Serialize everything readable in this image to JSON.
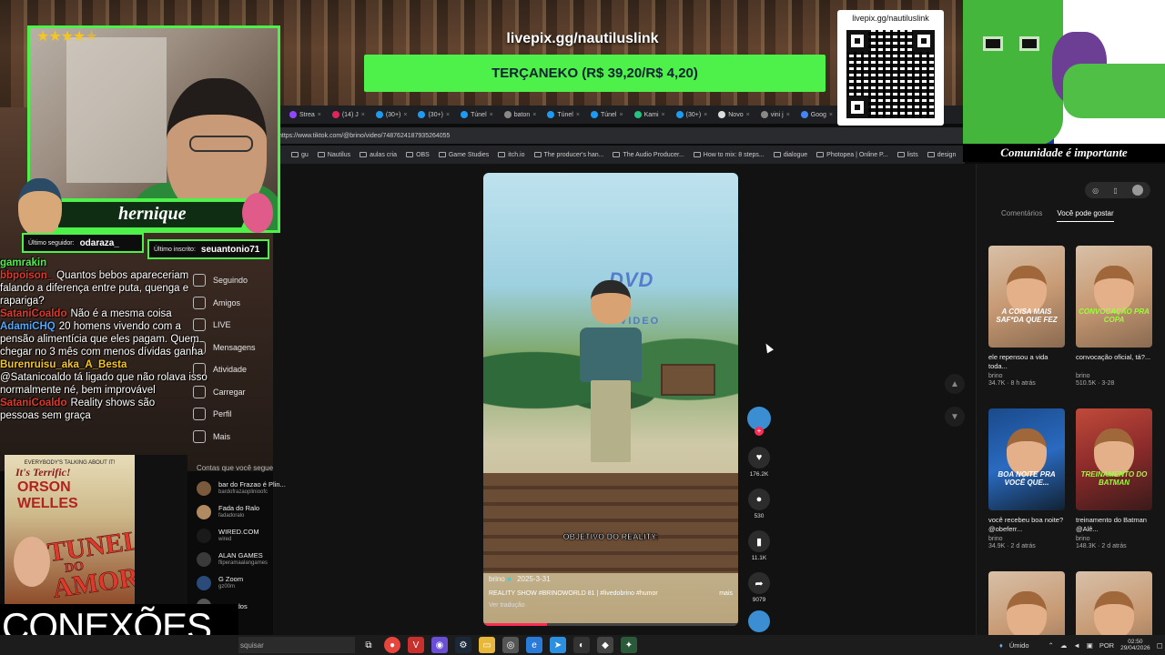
{
  "stream": {
    "livepix_url": "livepix.gg/nautiluslink",
    "goal_text": "TERÇANEKO (R$ 39,20/R$ 4,20)",
    "qr_label": "livepix.gg/nautiluslink",
    "community_tag": "Comunidade é importante",
    "streamer_name": "hernique",
    "star_rating": 4.5,
    "last_follower_label": "Último seguidor:",
    "last_follower": "odaraza_",
    "last_sub_label": "Último inscrito:",
    "last_sub": "seuantonio71",
    "accent_color": "#4ef04a",
    "bottom_banner": "CONEXÕES",
    "poster": {
      "tagline": "EVERYBODY'S TALKING ABOUT IT!",
      "terrific": "It's Terrific!",
      "actor_line1": "ORSON",
      "actor_line2": "WELLES",
      "title_line1": "TUNEL",
      "title_line2": "DO",
      "title_line3": "AMOR"
    }
  },
  "chat": [
    {
      "user": "gamrakin",
      "text": "",
      "color": "#4ef04a"
    },
    {
      "user": "bbpoison_",
      "text": "Quantos bebos apareceriam",
      "color": "#e0392b"
    },
    {
      "user": "",
      "text": "falando a diferença entre puta, quenga e",
      "color": "#fff"
    },
    {
      "user": "",
      "text": "rapariga?",
      "color": "#fff"
    },
    {
      "user": "SataniCoaldo",
      "text": "Não é a mesma coisa",
      "color": "#e0392b"
    },
    {
      "user": "AdamiCHQ",
      "text": "20 homens vivendo com a",
      "color": "#4fa8ff"
    },
    {
      "user": "",
      "text": "pensão alimentícia que eles pagam. Quem",
      "color": "#fff"
    },
    {
      "user": "",
      "text": "chegar no 3 mês com menos dívidas ganha",
      "color": "#fff"
    },
    {
      "user": "Burenruisu_aka_A_Besta",
      "text": "",
      "color": "#f6c51e"
    },
    {
      "user": "",
      "text": "@Satanicoaldo tá ligado que não rolava isso",
      "color": "#fff"
    },
    {
      "user": "",
      "text": "normalmente né, bem improvável",
      "color": "#fff"
    },
    {
      "user": "SataniCoaldo",
      "text": "Reality shows são",
      "color": "#e0392b"
    },
    {
      "user": "",
      "text": "pessoas sem graça",
      "color": "#fff"
    }
  ],
  "browser": {
    "tabs": [
      "Strea",
      "(14) J",
      "(30+)",
      "(30+)",
      "Túnel",
      "baton",
      "Túnel",
      "Túnel",
      "Kami",
      "(30+)",
      "Novo",
      "vini j",
      "Goog",
      "Dev"
    ],
    "url": "https://www.tiktok.com/@brino/video/7487624187935264055",
    "bookmarks": [
      "gu",
      "Nautilus",
      "aulas cria",
      "OBS",
      "Game Studies",
      "itch.io",
      "The producer's han...",
      "The Audio Producer...",
      "How to mix: 8 steps...",
      "dialogue",
      "Photopea | Online P...",
      "lists",
      "design"
    ]
  },
  "tiktok": {
    "nav": [
      "Seguindo",
      "Amigos",
      "LIVE",
      "Mensagens",
      "Atividade",
      "Carregar",
      "Perfil",
      "Mais"
    ],
    "following_title": "Contas que você segue",
    "accounts": [
      {
        "name": "bar do Frazao é Plin...",
        "handle": "bardofrazaoplinioofc"
      },
      {
        "name": "Fada do Ralo",
        "handle": "fadadoralo"
      },
      {
        "name": "WIRED.COM",
        "handle": "wired"
      },
      {
        "name": "ALAN GAMES",
        "handle": "fliperamaalangames"
      },
      {
        "name": "G Zoom",
        "handle": "gz00m"
      },
      {
        "name": "Ver todos",
        "handle": ""
      }
    ],
    "video": {
      "overlay_logo": "DVD",
      "overlay_logo_sub": "VIDEO",
      "caption": "OBJETIVO DO REALITY:",
      "author": "brino",
      "date": "2025-3-31",
      "description": "REALITY SHOW #BRINOWORLD 81 | #livedobrino #humor",
      "more_label": "mais",
      "translate_label": "Ver tradução",
      "progress": 0.25
    },
    "actions": {
      "likes": "176.2K",
      "comments": "530",
      "saves": "11.1K",
      "shares": "9079"
    },
    "right_tabs": [
      "Comentários",
      "Você pode gostar"
    ],
    "active_right_tab": "Você pode gostar",
    "suggestions": [
      {
        "thumb_caption": "A COISA MAIS SAF*DA QUE FEZ",
        "caption_color": "#ffffff",
        "title": "ele repensou a vida toda...",
        "author": "brino",
        "views": "34.7K",
        "age": "8 h atrás"
      },
      {
        "thumb_caption": "CONVOCAÇÃO PRA COPA",
        "caption_color": "#9aff3a",
        "title": "convocação oficial, tá?...",
        "author": "brino",
        "views": "510.5K",
        "age": "3-28"
      },
      {
        "thumb_caption": "BOA NOITE PRA VOCÊ QUE...",
        "caption_color": "#ffffff",
        "title": "você recebeu boa noite? @obeferr...",
        "author": "brino",
        "views": "34.9K",
        "age": "2 d atrás"
      },
      {
        "thumb_caption": "TREINAMENTO DO BATMAN",
        "caption_color": "#9aff3a",
        "title": "treinamento do Batman @Alê...",
        "author": "brino",
        "views": "148.3K",
        "age": "2 d atrás"
      },
      {
        "thumb_caption": "",
        "caption_color": "#ffffff",
        "title": "",
        "author": "",
        "views": "",
        "age": ""
      },
      {
        "thumb_caption": "",
        "caption_color": "#ffffff",
        "title": "",
        "author": "",
        "views": "",
        "age": ""
      }
    ]
  },
  "taskbar": {
    "search_placeholder": "squisar",
    "weather": "Úmido",
    "lang": "POR",
    "time": "02:50",
    "date": "29/04/2026"
  }
}
